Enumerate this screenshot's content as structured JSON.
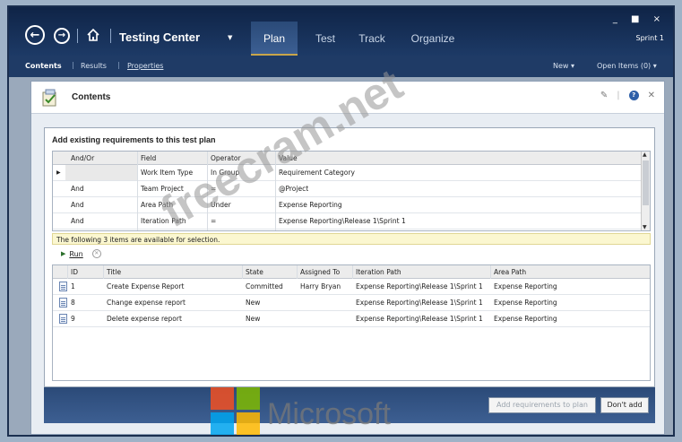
{
  "window": {
    "controls": "_ ■ ×",
    "sprint": "Sprint 1"
  },
  "nav": {
    "title": "Testing Center",
    "tabs": [
      {
        "label": "Plan",
        "active": true
      },
      {
        "label": "Test",
        "active": false
      },
      {
        "label": "Track",
        "active": false
      },
      {
        "label": "Organize",
        "active": false
      }
    ]
  },
  "subnav": {
    "contents": "Contents",
    "results": "Results",
    "properties": "Properties",
    "new": "New ▾",
    "open_items": "Open Items (0) ▾"
  },
  "panel": {
    "title": "Contents"
  },
  "dialog": {
    "title": "Add existing requirements to this test plan",
    "query_headers": [
      "And/Or",
      "Field",
      "Operator",
      "Value"
    ],
    "query_rows": [
      [
        "",
        "Work Item Type",
        "In Group",
        "Requirement Category"
      ],
      [
        "And",
        "Team Project",
        "=",
        "@Project"
      ],
      [
        "And",
        "Area Path",
        "Under",
        "Expense Reporting"
      ],
      [
        "And",
        "Iteration Path",
        "=",
        "Expense Reporting\\Release 1\\Sprint 1"
      ]
    ],
    "info": "The following 3 items are available for selection.",
    "run_label": "Run",
    "result_headers": [
      "ID",
      "Title",
      "State",
      "Assigned To",
      "Iteration Path",
      "Area Path"
    ],
    "result_rows": [
      [
        "1",
        "Create Expense Report",
        "Committed",
        "Harry Bryan",
        "Expense Reporting\\Release 1\\Sprint 1",
        "Expense Reporting"
      ],
      [
        "8",
        "Change expense report",
        "New",
        "",
        "Expense Reporting\\Release 1\\Sprint 1",
        "Expense Reporting"
      ],
      [
        "9",
        "Delete expense report",
        "New",
        "",
        "Expense Reporting\\Release 1\\Sprint 1",
        "Expense Reporting"
      ]
    ]
  },
  "footer": {
    "add_button": "Add requirements to plan",
    "dont_add_button": "Don't add"
  },
  "watermark": {
    "site": "freecram.net",
    "brand": "Microsoft"
  },
  "colors": {
    "nav_bg": "#1d3a66",
    "accent_gold": "#c9a64a",
    "info_bg": "#fbf7d0",
    "ms_red": "#f25022",
    "ms_green": "#7fba00",
    "ms_blue": "#00a4ef",
    "ms_yellow": "#ffb900"
  }
}
